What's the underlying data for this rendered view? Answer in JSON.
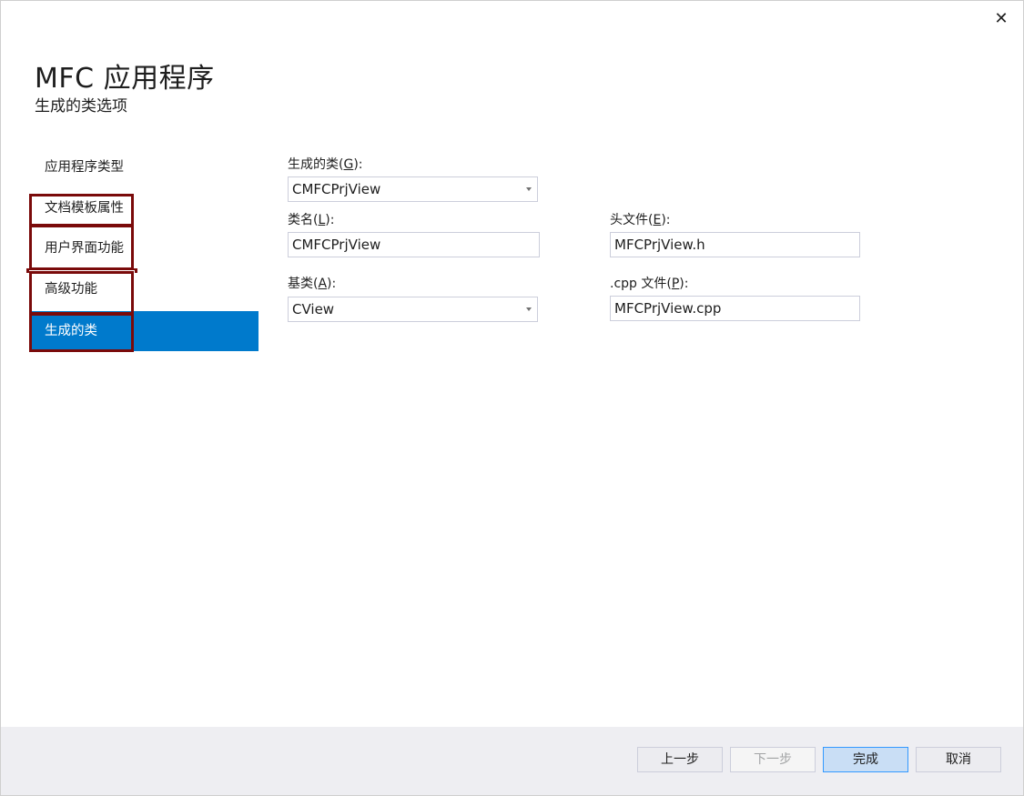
{
  "dialog": {
    "title": "MFC 应用程序",
    "subtitle": "生成的类选项",
    "close_glyph": "✕"
  },
  "sidebar": {
    "items": [
      {
        "label": "应用程序类型",
        "selected": false
      },
      {
        "label": "文档模板属性",
        "selected": false
      },
      {
        "label": "用户界面功能",
        "selected": false
      },
      {
        "label": "高级功能",
        "selected": false
      },
      {
        "label": "生成的类",
        "selected": true
      }
    ],
    "selected_color": "#007acc",
    "annotation_color": "#7a0a0a"
  },
  "form": {
    "generated_class": {
      "label_pre": "生成的类(",
      "label_key": "G",
      "label_post": "):",
      "value": "CMFCPrjView"
    },
    "class_name": {
      "label_pre": "类名(",
      "label_key": "L",
      "label_post": "):",
      "value": "CMFCPrjView"
    },
    "header_file": {
      "label_pre": "头文件(",
      "label_key": "E",
      "label_post": "):",
      "value": "MFCPrjView.h"
    },
    "base_class": {
      "label_pre": "基类(",
      "label_key": "A",
      "label_post": "):",
      "value": "CView"
    },
    "cpp_file": {
      "label_pre": ".cpp 文件(",
      "label_key": "P",
      "label_post": "):",
      "value": "MFCPrjView.cpp"
    }
  },
  "footer": {
    "prev": "上一步",
    "next": "下一步",
    "finish": "完成",
    "cancel": "取消"
  }
}
